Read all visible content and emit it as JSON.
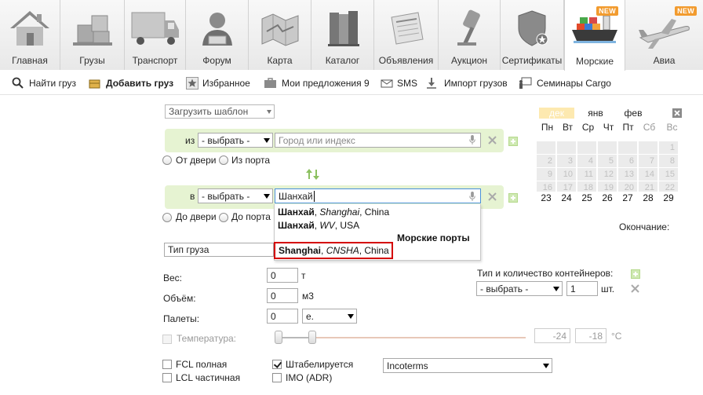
{
  "nav": {
    "tabs": [
      {
        "label": "Главная",
        "icon": "house-icon"
      },
      {
        "label": "Грузы",
        "icon": "boxes-icon"
      },
      {
        "label": "Транспорт",
        "icon": "truck-icon"
      },
      {
        "label": "Форум",
        "icon": "forum-user-icon"
      },
      {
        "label": "Карта",
        "icon": "map-icon"
      },
      {
        "label": "Каталог",
        "icon": "books-icon"
      },
      {
        "label": "Объявления",
        "icon": "newspaper-icon"
      },
      {
        "label": "Аукцион",
        "icon": "gavel-icon"
      },
      {
        "label": "Сертификаты",
        "icon": "shield-icon"
      },
      {
        "label": "Морские",
        "icon": "ship-icon",
        "badge": "NEW"
      },
      {
        "label": "Авиа",
        "icon": "airplane-icon",
        "badge": "NEW"
      }
    ]
  },
  "toolbar": {
    "find_cargo": "Найти груз",
    "add_cargo": "Добавить груз",
    "favorites": "Избранное",
    "my_offers": "Мои предложения 9",
    "sms": "SMS",
    "import": "Импорт грузов",
    "seminars": "Семинары Cargo"
  },
  "form": {
    "template_select": "Загрузить шаблон",
    "from": {
      "label": "из",
      "select": "- выбрать -",
      "placeholder": "Город или индекс"
    },
    "from_door": "От двери",
    "from_port": "Из порта",
    "to": {
      "label": "в",
      "select": "- выбрать -",
      "value": "Шанхай"
    },
    "to_door": "До двери",
    "to_port": "До порта",
    "cargo_type": "Тип груза",
    "weight_label": "Вес:",
    "weight_value": "0",
    "weight_unit": "т",
    "volume_label": "Объём:",
    "volume_value": "0",
    "volume_unit": "м3",
    "pallets_label": "Палеты:",
    "pallets_value": "0",
    "pallets_unit": "е.",
    "temperature_label": "Температура:",
    "temp_min": "-24",
    "temp_max": "-18",
    "temp_unit": "°C",
    "containers_label": "Тип и количество контейнеров:",
    "containers_select": "- выбрать -",
    "containers_qty": "1",
    "containers_unit": "шт.",
    "end_label": "Окончание:",
    "fcl": "FCL полная",
    "lcl": "LCL частичная",
    "stackable": "Штабелируется",
    "imo": "IMO (ADR)",
    "incoterms": "Incoterms"
  },
  "suggestions": {
    "items": [
      {
        "bold": "Шанхай",
        "sep": ", ",
        "italic": "Shanghai",
        "rest": ", China"
      },
      {
        "bold": "Шанхай",
        "sep": ", ",
        "italic": "WV",
        "rest": ", USA"
      }
    ],
    "ports_header": "Морские порты",
    "port_item": {
      "bold": "Shanghai",
      "sep": ", ",
      "italic": "CNSHA",
      "rest": ", China"
    }
  },
  "calendar": {
    "months": [
      "дек",
      "янв",
      "фев"
    ],
    "current_month_index": 0,
    "dow": [
      "Пн",
      "Вт",
      "Ср",
      "Чт",
      "Пт",
      "Сб",
      "Вс"
    ],
    "weekend_indices": [
      5,
      6
    ],
    "row1": [
      "",
      "",
      "",
      "",
      "",
      "",
      "1"
    ],
    "row2": [
      "2",
      "3",
      "4",
      "5",
      "6",
      "7",
      "8"
    ],
    "row3": [
      "9",
      "10",
      "11",
      "12",
      "13",
      "14",
      "15"
    ],
    "row4": [
      "16",
      "17",
      "18",
      "19",
      "20",
      "21",
      "22"
    ],
    "row5": [
      "23",
      "24",
      "25",
      "26",
      "27",
      "28",
      "29"
    ],
    "colors": {
      "current_month_bg": "#fde9b0",
      "cell_bg": "#ebebeb"
    }
  },
  "colors": {
    "green_band": "#e6f3d2",
    "highlight": "#d40000",
    "badge": "#f29b2e"
  }
}
